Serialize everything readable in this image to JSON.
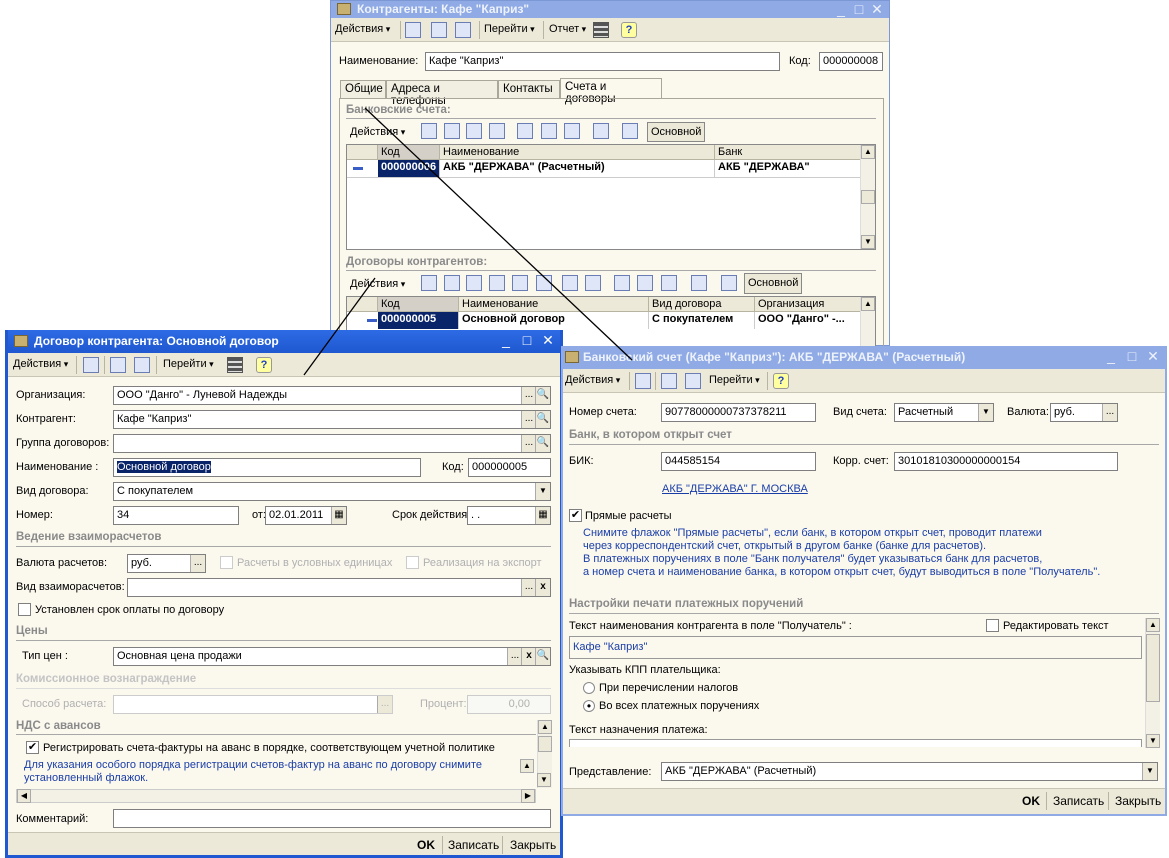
{
  "common": {
    "actions": "Действия",
    "goto": "Перейти",
    "report": "Отчет",
    "help": "?",
    "ellipsis": "...",
    "clear": "x",
    "ok": "OK",
    "write": "Записать",
    "close": "Закрыть",
    "minimize": "_",
    "maximize": "□",
    "close_x": "✕",
    "check": "✔",
    "radio_dot": "•",
    "down": "▼"
  },
  "counterparty": {
    "title": "Контрагенты: Кафе \"Каприз\"",
    "name_label": "Наименование:",
    "name_value": "Кафе \"Каприз\"",
    "code_label": "Код:",
    "code_value": "000000008",
    "tabs": [
      "Общие",
      "Адреса и телефоны",
      "Контакты",
      "Счета и договоры"
    ],
    "bank_accounts": {
      "header": "Банковские счета:",
      "main_button": "Основной",
      "columns": [
        "Код",
        "Наименование",
        "Банк"
      ],
      "rows": [
        {
          "code": "000000006",
          "name": "АКБ \"ДЕРЖАВА\" (Расчетный)",
          "bank": "АКБ \"ДЕРЖАВА\""
        }
      ]
    },
    "contracts": {
      "header": "Договоры контрагентов:",
      "main_button": "Основной",
      "columns": [
        "Код",
        "Наименование",
        "Вид договора",
        "Организация"
      ],
      "rows": [
        {
          "code": "000000005",
          "name": "Основной договор",
          "type": "С покупателем",
          "org": "ООО \"Данго\" -..."
        }
      ]
    }
  },
  "contract": {
    "title": "Договор контрагента: Основной договор",
    "org_label": "Организация:",
    "org_value": "ООО \"Данго\" - Луневой Надежды",
    "cp_label": "Контрагент:",
    "cp_value": "Кафе \"Каприз\"",
    "group_label": "Группа договоров:",
    "group_value": "",
    "name_label": "Наименование :",
    "name_value": "Основной договор",
    "code_label": "Код:",
    "code_value": "000000005",
    "type_label": "Вид договора:",
    "type_value": "С покупателем",
    "number_label": "Номер:",
    "number_value": "34",
    "from_label": "от:",
    "from_value": "02.01.2011",
    "term_label": "Срок действия:",
    "term_value": " .  .",
    "settlements_header": "Ведение взаиморасчетов",
    "currency_label": "Валюта расчетов:",
    "currency_value": "руб.",
    "conv_units_label": "Расчеты в условных единицах",
    "export_label": "Реализация на экспорт",
    "settle_type_label": "Вид взаиморасчетов:",
    "settle_type_value": "",
    "payment_term_label": "Установлен срок оплаты по договору",
    "prices_header": "Цены",
    "price_type_label": "Тип цен :",
    "price_type_value": "Основная цена продажи",
    "commission_header": "Комиссионное вознаграждение",
    "calc_method_label": "Способ расчета:",
    "calc_method_value": "",
    "percent_label": "Процент:",
    "percent_value": "0,00",
    "vat_header": "НДС с авансов",
    "vat_checkbox_label": "Регистрировать счета-фактуры на аванс в порядке, соответствующем учетной политике",
    "vat_hint_line1": "Для указания особого порядка регистрации счетов-фактур на аванс по договору снимите",
    "vat_hint_line2": "установленный флажок.",
    "comment_label": "Комментарий:",
    "comment_value": ""
  },
  "bank_account": {
    "title": "Банковский счет (Кафе \"Каприз\"): АКБ \"ДЕРЖАВА\" (Расчетный)",
    "number_label": "Номер счета:",
    "number_value": "90778000000737378211",
    "kind_label": "Вид счета:",
    "kind_value": "Расчетный",
    "currency_label": "Валюта:",
    "currency_value": "руб.",
    "bank_header": "Банк, в котором открыт счет",
    "bik_label": "БИК:",
    "bik_value": "044585154",
    "corr_label": "Корр. счет:",
    "corr_value": "30101810300000000154",
    "bank_link": "АКБ \"ДЕРЖАВА\" Г. МОСКВА",
    "direct_label": "Прямые расчеты",
    "hint": [
      "Снимите флажок \"Прямые расчеты\", если банк, в котором открыт счет, проводит платежи",
      "через корреспондентский счет, открытый в другом банке (банке для расчетов).",
      "В платежных поручениях в поле \"Банк получателя\" будет указываться банк для расчетов,",
      "а номер счета и наименование банка, в котором открыт счет, будут выводиться в поле \"Получатель\"."
    ],
    "print_header": "Настройки печати платежных поручений",
    "recipient_text_label": "Текст наименования контрагента в поле \"Получатель\" :",
    "edit_text_label": "Редактировать текст",
    "recipient_text_value": "Кафе \"Каприз\"",
    "kpp_label": "Указывать КПП плательщика:",
    "kpp_options": [
      "При перечислении налогов",
      "Во всех платежных поручениях"
    ],
    "purpose_label": "Текст назначения платежа:",
    "presentation_label": "Представление:",
    "presentation_value": "АКБ \"ДЕРЖАВА\" (Расчетный)"
  }
}
